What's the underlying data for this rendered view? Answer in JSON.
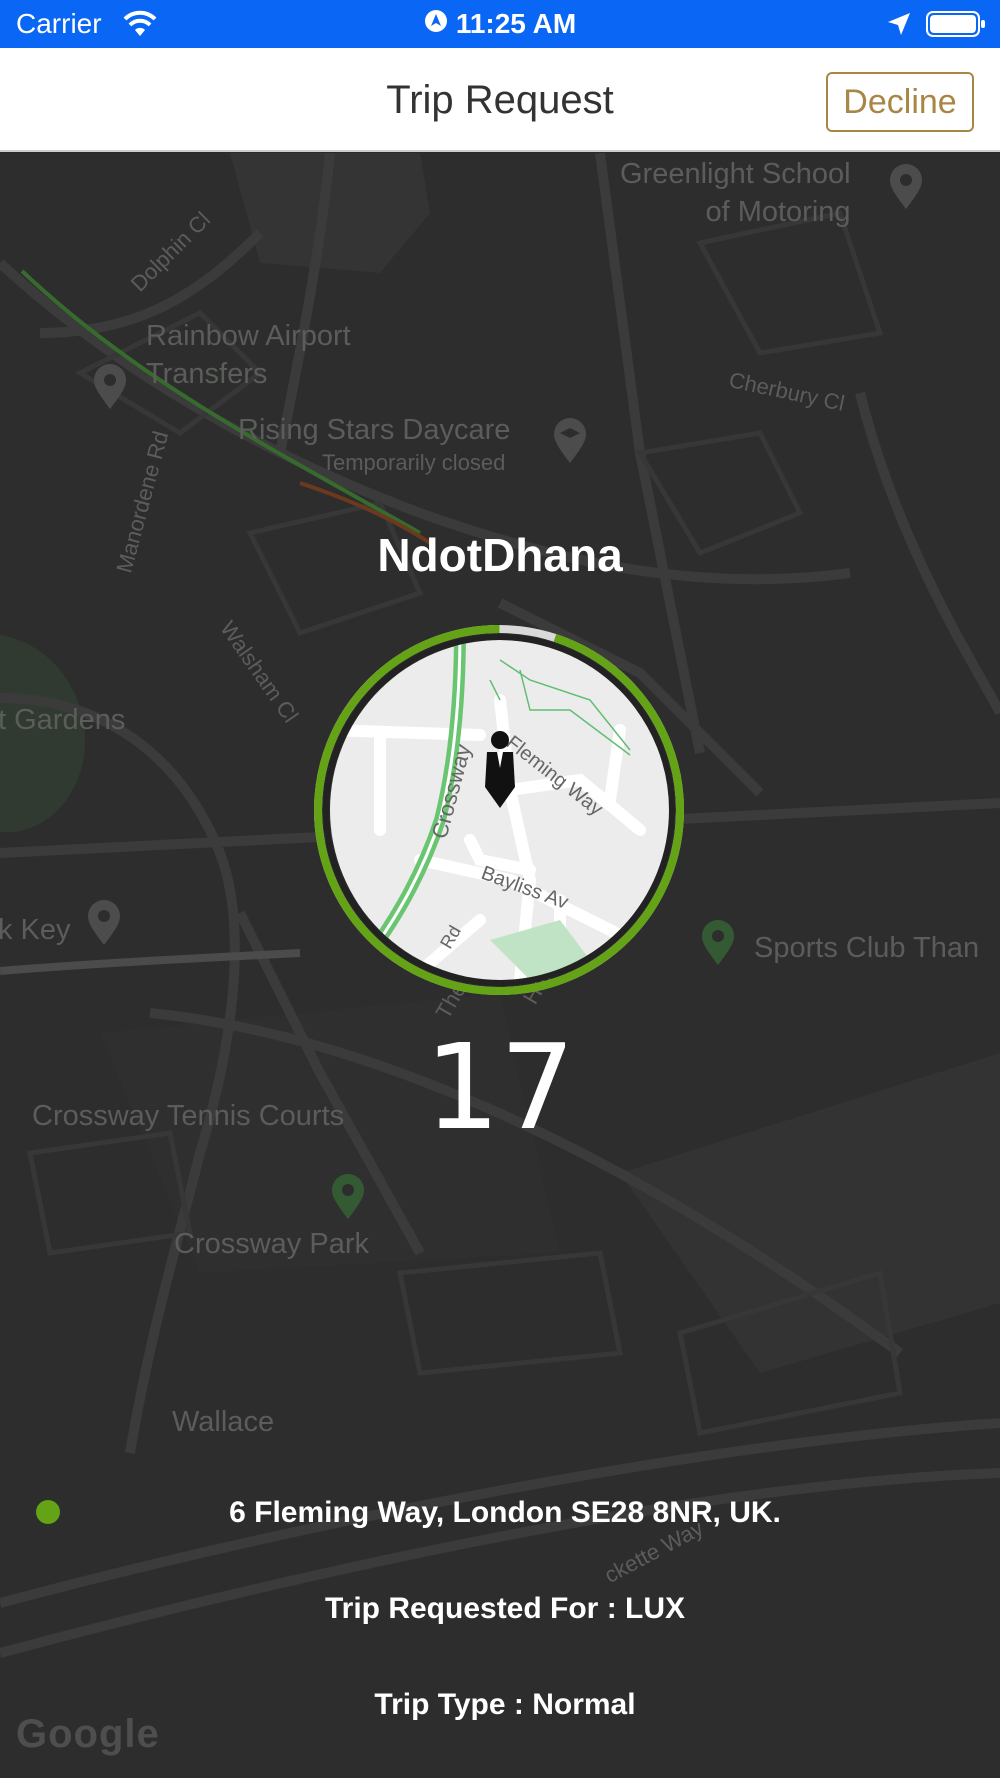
{
  "status_bar": {
    "carrier": "Carrier",
    "time": "11:25 AM"
  },
  "header": {
    "title": "Trip Request",
    "decline_label": "Decline"
  },
  "map": {
    "labels": [
      "Greenlight School",
      "of Motoring",
      "Dolphin Cl",
      "Rainbow Airport",
      "Transfers",
      "Cherbury Cl",
      "Rising Stars Daycare",
      "Temporarily closed",
      "Manordene Rd",
      "Walsham Cl",
      "t Gardens",
      "k Key",
      "Sports Club Than",
      "Crossway Tennis Courts",
      "Crossway Park",
      "The Archway",
      "Haldane Rd",
      "Wallace",
      "ckette Way"
    ],
    "mini_labels": [
      "Crossway",
      "Fleming Way",
      "Bayliss Av",
      "Rd"
    ],
    "attribution": "Google"
  },
  "trip": {
    "driver_name": "NdotDhana",
    "countdown": "17",
    "countdown_progress": 0.95,
    "pickup_address": "6 Fleming Way, London SE28 8NR, UK.",
    "requested_for": "Trip Requested For : LUX",
    "trip_type": "Trip Type : Normal"
  },
  "colors": {
    "accent": "#64a315",
    "status_bar": "#0a67f5",
    "decline": "#a88746"
  },
  "icons": [
    "wifi-icon",
    "location-services-icon",
    "location-arrow-icon",
    "battery-icon",
    "map-pin-icon",
    "school-icon",
    "person-icon"
  ]
}
